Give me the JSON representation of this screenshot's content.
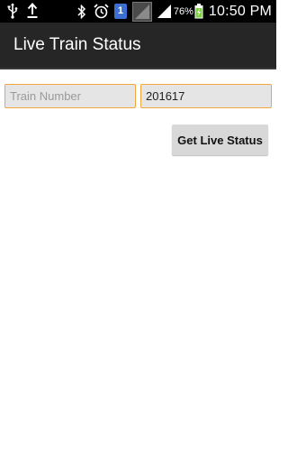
{
  "status_bar": {
    "icons": [
      "usb-icon",
      "upload-icon",
      "bluetooth-icon",
      "alarm-icon",
      "sim-icon",
      "no-signal-icon",
      "signal-icon",
      "battery-icon"
    ],
    "sim_number": "1",
    "battery_percent": "76%",
    "time": "10:50 PM"
  },
  "app": {
    "title": "Live Train Status"
  },
  "form": {
    "train_number": {
      "placeholder": "Train Number",
      "value": ""
    },
    "second_field": {
      "value": "201617"
    },
    "button_label": "Get Live Status"
  },
  "colors": {
    "status_bar": "#000000",
    "action_bar": "#262626",
    "field_border": "#f2a640",
    "field_bg": "#e5e5e5",
    "button_bg": "#d8d8d8",
    "sim_badge": "#3d6fd1",
    "battery_charge": "#7bd13c"
  }
}
